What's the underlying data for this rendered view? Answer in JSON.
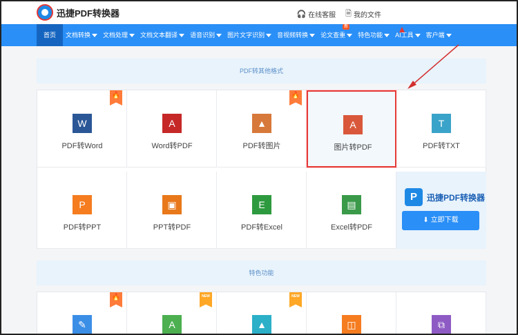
{
  "header": {
    "logo_text": "迅捷PDF转换器",
    "online_service": "在线客服",
    "my_files": "我的文件"
  },
  "nav": {
    "items": [
      {
        "label": "首页",
        "active": true,
        "dropdown": false
      },
      {
        "label": "文档转换",
        "dropdown": true
      },
      {
        "label": "文档处理",
        "dropdown": true
      },
      {
        "label": "文档文本翻译",
        "dropdown": true
      },
      {
        "label": "语音识别",
        "dropdown": true
      },
      {
        "label": "图片文字识别",
        "dropdown": true
      },
      {
        "label": "音视频转换",
        "dropdown": true
      },
      {
        "label": "论文查重",
        "dropdown": true,
        "badge": "新"
      },
      {
        "label": "特色功能",
        "dropdown": true
      },
      {
        "label": "AI工具",
        "dropdown": true
      },
      {
        "label": "客户端",
        "dropdown": true
      }
    ]
  },
  "section1": {
    "title": "PDF转其他格式",
    "row1": [
      {
        "label": "PDF转Word",
        "icon": "W",
        "icon_name": "word-icon",
        "color": "#2b5797",
        "hot": true
      },
      {
        "label": "Word转PDF",
        "icon": "A",
        "icon_name": "pdf-icon",
        "color": "#c62828",
        "hot": false
      },
      {
        "label": "PDF转图片",
        "icon": "▲",
        "icon_name": "image-icon",
        "color": "#d7793a",
        "hot": true
      },
      {
        "label": "图片转PDF",
        "icon": "A",
        "icon_name": "pdf-icon",
        "color": "#d9583b",
        "hot": false,
        "selected": true
      },
      {
        "label": "PDF转TXT",
        "icon": "T",
        "icon_name": "txt-icon",
        "color": "#3aa3c9",
        "hot": false
      }
    ],
    "row2": [
      {
        "label": "PDF转PPT",
        "icon": "P",
        "icon_name": "ppt-icon",
        "color": "#f57c1f"
      },
      {
        "label": "PPT转PDF",
        "icon": "▣",
        "icon_name": "ppt-pdf-icon",
        "color": "#e8781a"
      },
      {
        "label": "PDF转Excel",
        "icon": "E",
        "icon_name": "excel-icon",
        "color": "#2e9a3f"
      },
      {
        "label": "Excel转PDF",
        "icon": "▤",
        "icon_name": "excel-pdf-icon",
        "color": "#3a9a4a"
      }
    ],
    "promo": {
      "name": "迅捷PDF转换器",
      "mark": "P",
      "button": "立即下载"
    }
  },
  "section2": {
    "title": "特色功能",
    "row": [
      {
        "icon": "✎",
        "icon_name": "edit-icon",
        "color": "#3b8ee6",
        "tag": "hot"
      },
      {
        "icon": "A",
        "icon_name": "pdf-icon",
        "color": "#4caf50",
        "tag": "new",
        "tag_text": "NEW"
      },
      {
        "icon": "▲",
        "icon_name": "image-icon",
        "color": "#2bb0c8",
        "tag": "new",
        "tag_text": "NEW"
      },
      {
        "icon": "◫",
        "icon_name": "crop-icon",
        "color": "#f57c1f",
        "tag": ""
      },
      {
        "icon": "⧉",
        "icon_name": "merge-icon",
        "color": "#8e5bc4",
        "tag": ""
      }
    ]
  }
}
